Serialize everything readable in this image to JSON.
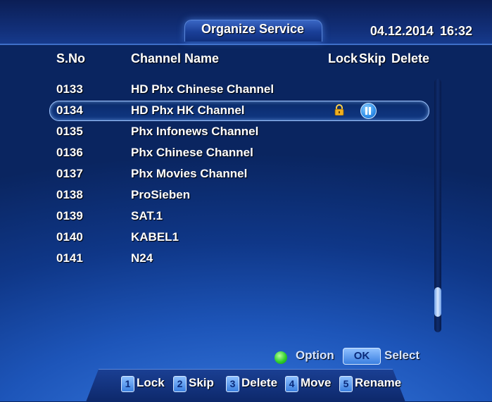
{
  "header": {
    "title": "Organize Service",
    "date": "04.12.2014",
    "time": "16:32"
  },
  "columns": {
    "sno": "S.No",
    "name": "Channel Name",
    "lock": "Lock",
    "skip": "Skip",
    "delete": "Delete"
  },
  "channels": [
    {
      "no": "0133",
      "name": "HD Phx Chinese Channel"
    },
    {
      "no": "0134",
      "name": "HD Phx HK Channel",
      "locked": true,
      "skipped": true
    },
    {
      "no": "0135",
      "name": "Phx Infonews Channel"
    },
    {
      "no": "0136",
      "name": "Phx Chinese Channel"
    },
    {
      "no": "0137",
      "name": "Phx Movies Channel"
    },
    {
      "no": "0138",
      "name": "ProSieben"
    },
    {
      "no": "0139",
      "name": "SAT.1"
    },
    {
      "no": "0140",
      "name": "KABEL1"
    },
    {
      "no": "0141",
      "name": "N24"
    }
  ],
  "selected_index": 1,
  "hints": {
    "option_label": "Option",
    "ok_key": "OK",
    "select_label": "Select"
  },
  "footer": [
    {
      "key": "1",
      "label": "Lock"
    },
    {
      "key": "2",
      "label": "Skip"
    },
    {
      "key": "3",
      "label": "Delete"
    },
    {
      "key": "4",
      "label": "Move"
    },
    {
      "key": "5",
      "label": "Rename"
    }
  ],
  "icons": {
    "lock": "padlock-icon",
    "skip": "pause-skip-icon",
    "option": "green-circle-icon"
  },
  "colors": {
    "background": "#1d55b9",
    "accent": "#3a7fe0",
    "option_green": "#2fd02c",
    "lock_gold": "#f0b020"
  }
}
